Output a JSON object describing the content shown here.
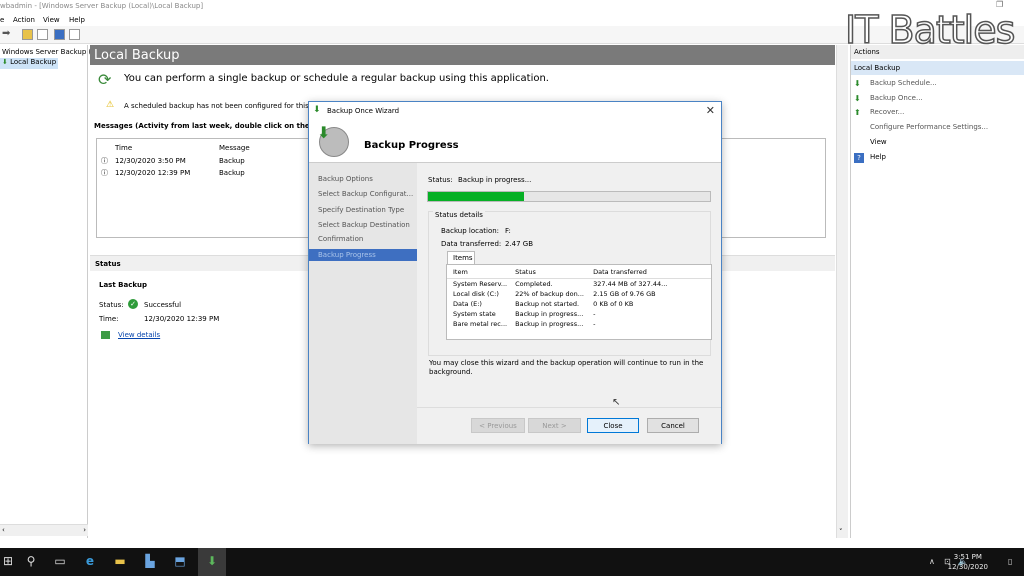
{
  "window": {
    "title": "wbadmin - [Windows Server Backup (Local)\\Local Backup]"
  },
  "menu": [
    "Action",
    "View",
    "Help"
  ],
  "tree": {
    "root": "Windows Server Backup (L",
    "child": "Local Backup"
  },
  "main": {
    "header": "Local Backup",
    "info": "You can perform a single backup or schedule a regular backup using this application.",
    "warning": "A scheduled backup has not been configured for this co",
    "messages_title": "Messages (Activity from last week, double click on the messa",
    "messages_cols": [
      "Time",
      "Message"
    ],
    "messages": [
      {
        "time": "12/30/2020 3:50 PM",
        "message": "Backup"
      },
      {
        "time": "12/30/2020 12:39 PM",
        "message": "Backup"
      }
    ],
    "status_header": "Status",
    "last_backup": "Last Backup",
    "status_label": "Status:",
    "status_value": "Successful",
    "time_label": "Time:",
    "time_value": "12/30/2020 12:39 PM",
    "view_details": "View details"
  },
  "actions": {
    "header": "Actions",
    "sub": "Local Backup",
    "items": [
      "Backup Schedule...",
      "Backup Once...",
      "Recover...",
      "Configure Performance Settings...",
      "View",
      "Help"
    ]
  },
  "watermark": "IT Battles",
  "dialog": {
    "title": "Backup Once Wizard",
    "heading": "Backup Progress",
    "nav": [
      "Backup Options",
      "Select Backup Configurat...",
      "Specify Destination Type",
      "Select Backup Destination",
      "Confirmation",
      "Backup Progress"
    ],
    "status_label": "Status:",
    "status_value": "Backup in progress...",
    "progress": 0.34,
    "details_title": "Status details",
    "location_label": "Backup location:",
    "location_value": "F:",
    "transferred_label": "Data transferred:",
    "transferred_value": "2.47 GB",
    "tab": "Items",
    "cols": [
      "Item",
      "Status",
      "Data transferred"
    ],
    "rows": [
      [
        "System Reserv...",
        "Completed.",
        "327.44 MB of 327.44..."
      ],
      [
        "Local disk (C:)",
        "22% of backup don...",
        "2.15 GB of 9.76 GB"
      ],
      [
        "Data (E:)",
        "Backup not started.",
        "0 KB of 0 KB"
      ],
      [
        "System state",
        "Backup in progress...",
        "-"
      ],
      [
        "Bare metal rec...",
        "Backup in progress...",
        "-"
      ]
    ],
    "note": "You may close this wizard and the backup operation will continue to run in the background.",
    "buttons": {
      "previous": "< Previous",
      "next": "Next >",
      "close": "Close",
      "cancel": "Cancel"
    }
  },
  "taskbar": {
    "time": "3:51 PM",
    "date": "12/30/2020"
  }
}
